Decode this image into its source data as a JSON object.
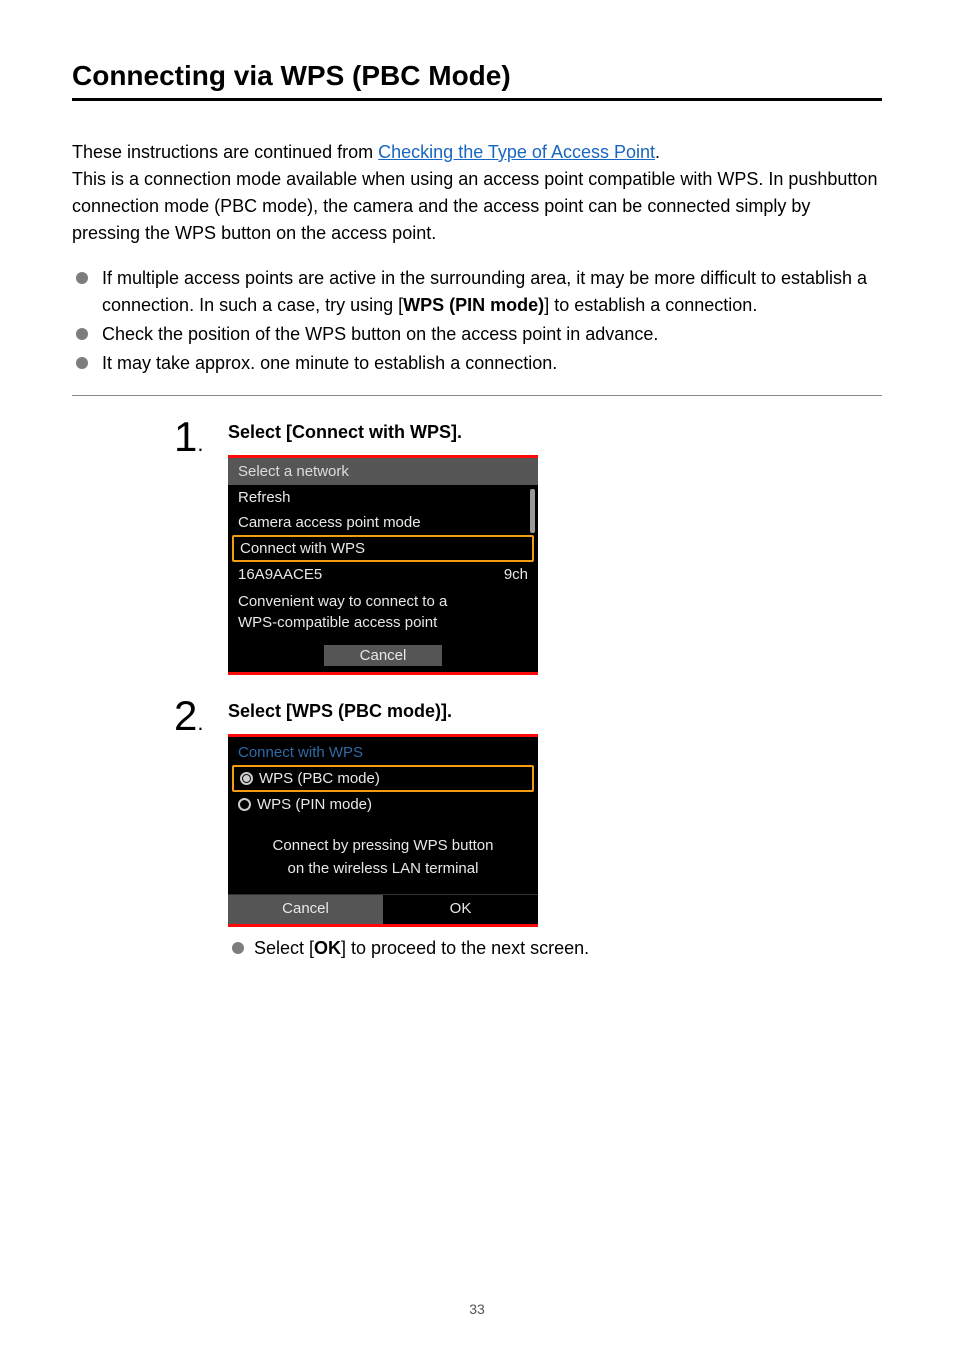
{
  "title": "Connecting via WPS (PBC Mode)",
  "intro": {
    "pre_link": "These instructions are continued from ",
    "link_text": "Checking the Type of Access Point",
    "post_link": ".",
    "desc": "This is a connection mode available when using an access point compatible with WPS. In pushbutton connection mode (PBC mode), the camera and the access point can be connected simply by pressing the WPS button on the access point."
  },
  "notes": {
    "n1_pre": "If multiple access points are active in the surrounding area, it may be more difficult to establish a connection. In such a case, try using [",
    "n1_bold": "WPS (PIN mode)",
    "n1_post": "] to establish a connection.",
    "n2": "Check the position of the WPS button on the access point in advance.",
    "n3": "It may take approx. one minute to establish a connection."
  },
  "step1": {
    "title": "Select [Connect with WPS].",
    "shot": {
      "header": "Select a network",
      "row1": "Refresh",
      "row2": "Camera access point mode",
      "row3": "Connect with WPS",
      "row4_left": "16A9AACE5",
      "row4_right": "9ch",
      "desc1": "Convenient way to connect to a",
      "desc2": "WPS-compatible access point",
      "cancel": "Cancel"
    }
  },
  "step2": {
    "title": "Select [WPS (PBC mode)].",
    "shot": {
      "header": "Connect with WPS",
      "opt1": "WPS (PBC mode)",
      "opt2": "WPS (PIN mode)",
      "desc1": "Connect by pressing WPS button",
      "desc2": "on the wireless LAN terminal",
      "cancel": "Cancel",
      "ok": "OK"
    },
    "sub_pre": "Select [",
    "sub_bold": "OK",
    "sub_post": "] to proceed to the next screen."
  },
  "page_number": "33"
}
